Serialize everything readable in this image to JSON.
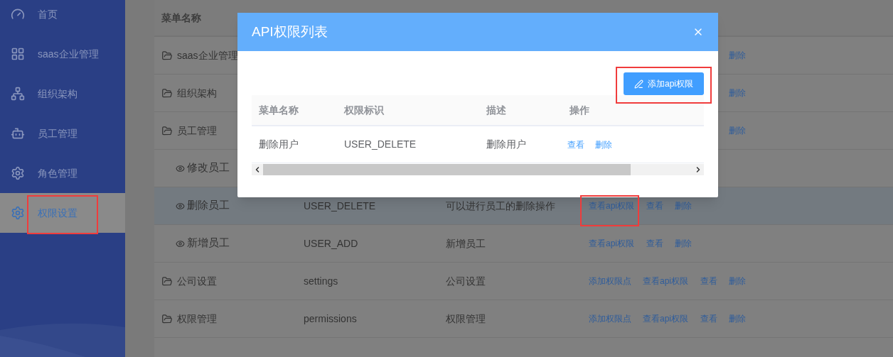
{
  "sidebar": {
    "items": [
      {
        "label": "首页",
        "selected": false
      },
      {
        "label": "saas企业管理",
        "selected": false
      },
      {
        "label": "组织架构",
        "selected": false
      },
      {
        "label": "员工管理",
        "selected": false
      },
      {
        "label": "角色管理",
        "selected": false
      },
      {
        "label": "权限设置",
        "selected": true
      }
    ]
  },
  "table": {
    "columns": [
      "菜单名称"
    ],
    "rows": [
      {
        "kind": "menu",
        "name": "saas企业管理",
        "selected": false,
        "actions": [
          {
            "kind": "delete",
            "label": "删除"
          }
        ]
      },
      {
        "kind": "menu",
        "name": "组织架构",
        "selected": false,
        "actions": [
          {
            "kind": "delete",
            "label": "删除"
          }
        ]
      },
      {
        "kind": "menu",
        "name": "员工管理",
        "selected": false,
        "actions": [
          {
            "kind": "delete",
            "label": "删除"
          }
        ],
        "children": [
          {
            "kind": "point",
            "name": "修改员工",
            "selected": false
          },
          {
            "kind": "point",
            "name": "删除员工",
            "key": "USER_DELETE",
            "description": "可以进行员工的删除操作",
            "selected": true,
            "actions": [
              {
                "kind": "api",
                "label": "查看api权限"
              },
              {
                "kind": "view",
                "label": "查看"
              },
              {
                "kind": "delete",
                "label": "删除"
              }
            ]
          },
          {
            "kind": "point",
            "name": "新增员工",
            "key": "USER_ADD",
            "description": "新增员工",
            "selected": false,
            "actions": [
              {
                "kind": "api",
                "label": "查看api权限"
              },
              {
                "kind": "view",
                "label": "查看"
              },
              {
                "kind": "delete",
                "label": "删除"
              }
            ]
          }
        ]
      },
      {
        "kind": "menu",
        "name": "公司设置",
        "key": "settings",
        "description": "公司设置",
        "selected": false,
        "actions": [
          {
            "kind": "add",
            "label": "添加权限点"
          },
          {
            "kind": "api",
            "label": "查看api权限"
          },
          {
            "kind": "view",
            "label": "查看"
          },
          {
            "kind": "delete",
            "label": "删除"
          }
        ]
      },
      {
        "kind": "menu",
        "name": "权限管理",
        "key": "permissions",
        "description": "权限管理",
        "selected": false,
        "actions": [
          {
            "kind": "add",
            "label": "添加权限点"
          },
          {
            "kind": "api",
            "label": "查看api权限"
          },
          {
            "kind": "view",
            "label": "查看"
          },
          {
            "kind": "delete",
            "label": "删除"
          }
        ]
      }
    ]
  },
  "dialog": {
    "title": "API权限列表",
    "add_button": "添加api权限",
    "table": {
      "columns": [
        "菜单名称",
        "权限标识",
        "描述",
        "操作"
      ],
      "rows": [
        {
          "name": "删除用户",
          "key": "USER_DELETE",
          "description": "删除用户",
          "actions": [
            "查看",
            "删除"
          ]
        }
      ]
    }
  }
}
